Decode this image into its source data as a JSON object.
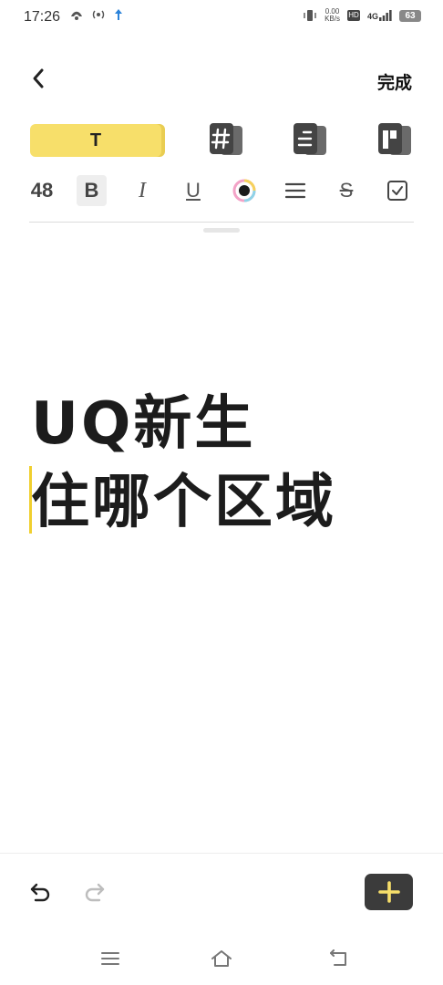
{
  "status_bar": {
    "time": "17:26",
    "net_speed_value": "0.00",
    "net_speed_unit": "KB/s",
    "hd_label": "HD",
    "network_label": "4G",
    "battery": "63"
  },
  "header": {
    "done_label": "完成"
  },
  "style_tabs": {
    "text_tab_label": "T",
    "accent_color": "#f7df6a"
  },
  "format_toolbar": {
    "font_size": "48",
    "bold_label": "B",
    "italic_label": "I",
    "underline_label": "U",
    "strike_label": "S"
  },
  "editor": {
    "lines": [
      "UQ新生",
      "住哪个区域"
    ]
  },
  "icons": [
    "back-arrow-icon",
    "hashtag-card-icon",
    "list-card-icon",
    "grid-card-icon",
    "color-picker-icon",
    "align-icon",
    "checkbox-icon",
    "undo-icon",
    "redo-icon",
    "plus-icon",
    "menu-icon",
    "home-icon",
    "return-icon"
  ]
}
